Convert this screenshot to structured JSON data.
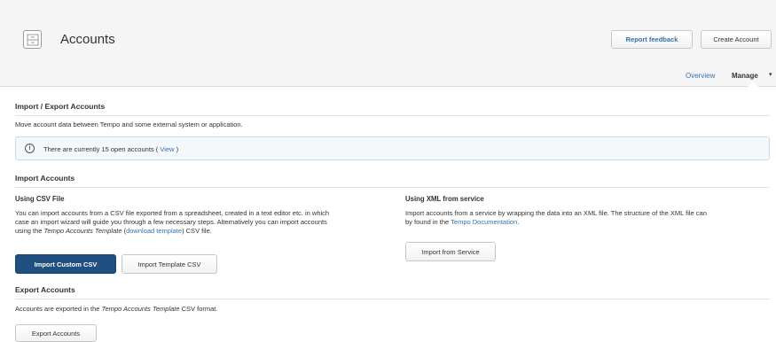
{
  "header": {
    "title": "Accounts",
    "report_feedback": "Report feedback",
    "create_account": "Create Account"
  },
  "subnav": {
    "overview": "Overview",
    "manage": "Manage",
    "manage_caret": "▾"
  },
  "import_export": {
    "title": "Import / Export Accounts",
    "description": "Move account data between Tempo and some external system or application.",
    "info": {
      "prefix": "There are currently 15 open accounts (",
      "link": "View",
      "suffix": ")"
    }
  },
  "import_accounts": {
    "title": "Import Accounts",
    "csv": {
      "title": "Using CSV File",
      "line1": "You can import accounts from a CSV file exported from a spreadsheet, created in a text editor etc. in which",
      "line2": "case an import wizard will guide you through a few necessary steps. Alternatively you can import accounts",
      "line3_pre": "using the ",
      "line3_em": "Tempo Accounts Template",
      "line3_mid": " (",
      "line3_link": "download template",
      "line3_post": ") CSV file.",
      "btn_custom": "Import Custom CSV",
      "btn_template": "Import Template CSV"
    },
    "xml": {
      "title": "Using XML from service",
      "line1": "Import accounts from a service by wrapping the data into an XML file. The structure of the XML file can",
      "line2_pre": "by found in the ",
      "line2_link": "Tempo Documentation",
      "line2_post": ".",
      "btn_service": "Import from Service"
    }
  },
  "export_accounts": {
    "title": "Export Accounts",
    "text_pre": "Accounts are exported in the ",
    "text_em": "Tempo Accounts Template",
    "text_post": " CSV format.",
    "btn_export": "Export Accounts"
  },
  "colors": {
    "primary": "#205081",
    "link": "#3572b0",
    "header_bg": "#f5f5f5"
  },
  "icons": {
    "header": "accounts-icon",
    "info": "info-icon"
  }
}
